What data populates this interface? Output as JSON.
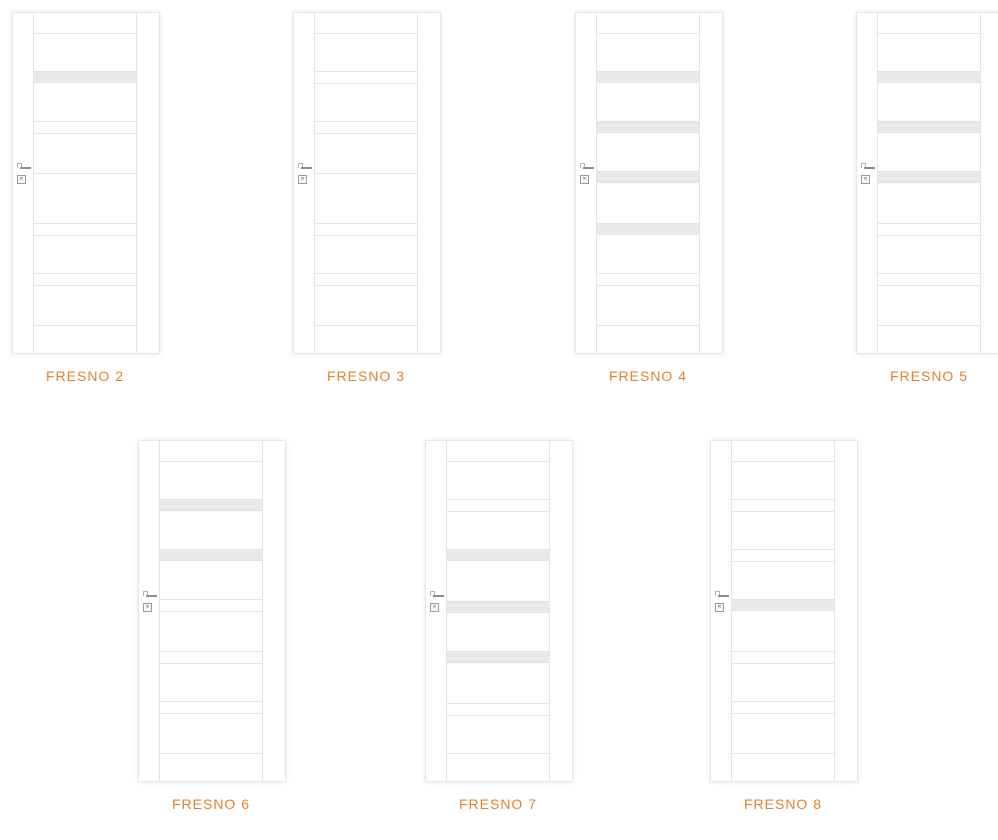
{
  "accent_color": "#e4812e",
  "products": [
    {
      "name": "FRESNO 2",
      "glass_panels": 1
    },
    {
      "name": "FRESNO 3",
      "glass_panels": 0
    },
    {
      "name": "FRESNO 4",
      "glass_panels": 4
    },
    {
      "name": "FRESNO 5",
      "glass_panels": 3
    },
    {
      "name": "FRESNO 6",
      "glass_panels": 2
    },
    {
      "name": "FRESNO 7",
      "glass_panels": 3
    },
    {
      "name": "FRESNO 8",
      "glass_panels": 1
    }
  ]
}
